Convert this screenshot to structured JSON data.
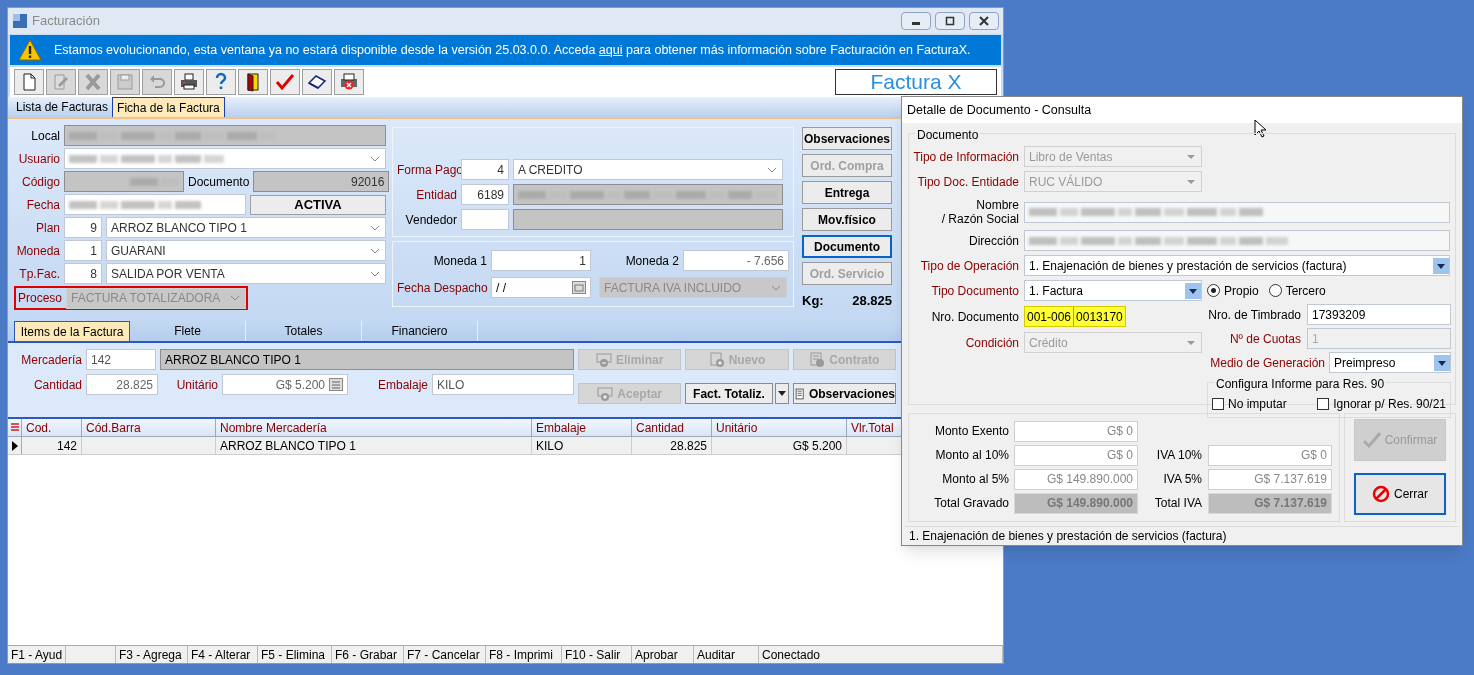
{
  "main": {
    "title": "Facturación",
    "notice": {
      "before": "Estamos evolucionando, esta ventana ya no estará disponible desde la versión 25.03.0.0. Acceda",
      "link": "aqui",
      "after": "para obtener más información sobre Facturación en FacturaX."
    },
    "toolbar": [
      {
        "kind": "new",
        "disabled": false
      },
      {
        "kind": "edit",
        "disabled": true
      },
      {
        "kind": "delete",
        "disabled": true
      },
      {
        "kind": "save",
        "disabled": true
      },
      {
        "kind": "undo",
        "disabled": true
      },
      {
        "kind": "print",
        "disabled": false
      },
      {
        "kind": "help",
        "disabled": false
      },
      {
        "kind": "exit",
        "disabled": false
      },
      {
        "kind": "check",
        "disabled": false
      },
      {
        "kind": "eraser",
        "disabled": false
      },
      {
        "kind": "print_cancel",
        "disabled": false
      }
    ],
    "logo": "Factura X",
    "tabs": [
      {
        "label": "Lista de Facturas",
        "selected": false
      },
      {
        "label": "Ficha de la Factura",
        "selected": true
      }
    ],
    "local": {
      "label": "Local",
      "required": false
    },
    "usuario": {
      "label": "Usuario",
      "required": true
    },
    "codigo": {
      "label": "Código",
      "required": true
    },
    "documento": {
      "label": "Documento",
      "value": "92016",
      "required": false
    },
    "fecha": {
      "label": "Fecha",
      "required": true
    },
    "status": "ACTIVA",
    "plan": {
      "label": "Plan",
      "code": "9",
      "value": "ARROZ BLANCO TIPO 1",
      "required": true
    },
    "moneda": {
      "label": "Moneda",
      "code": "1",
      "value": "GUARANI",
      "required": true
    },
    "tp_fac": {
      "label": "Tp.Fac.",
      "code": "8",
      "value": "SALIDA POR VENTA",
      "required": true
    },
    "proceso": {
      "label": "Proceso",
      "value": "FACTURA TOTALIZADORA",
      "required": true,
      "disabled": true,
      "highlighted": true
    },
    "forma_pago": {
      "label": "Forma Pago",
      "code": "4",
      "value": "A CREDITO",
      "required": true
    },
    "entidad": {
      "label": "Entidad",
      "code": "6189",
      "required": true
    },
    "vendedor": {
      "label": "Vendedor",
      "required": false
    },
    "moneda_1": {
      "label": "Moneda 1",
      "value": "1",
      "required": false
    },
    "moneda_2": {
      "label": "Moneda 2",
      "value": "- 7.656",
      "required": false
    },
    "fecha_despacho": {
      "label": "Fecha Despacho",
      "value": "/  /",
      "required": true
    },
    "tipo_factura": {
      "value": "FACTURA IVA INCLUIDO",
      "disabled": true
    },
    "side_buttons": [
      {
        "label": "Observaciones",
        "disabled": false,
        "focused": false
      },
      {
        "label": "Ord. Compra",
        "disabled": true,
        "focused": false
      },
      {
        "label": "Entrega",
        "disabled": false,
        "focused": false
      },
      {
        "label": "Mov.físico",
        "disabled": false,
        "focused": false
      },
      {
        "label": "Documento",
        "disabled": false,
        "focused": true
      },
      {
        "label": "Ord. Servicio",
        "disabled": true,
        "focused": false
      }
    ],
    "kg": {
      "label": "Kg:",
      "value": "28.825"
    },
    "item_tabs": [
      {
        "label": "Items de la Factura",
        "selected": true
      },
      {
        "label": "Flete",
        "selected": false
      },
      {
        "label": "Totales",
        "selected": false
      },
      {
        "label": "Financiero",
        "selected": false
      }
    ],
    "mercaderia": {
      "label": "Mercadería",
      "code": "142",
      "value": "ARROZ BLANCO TIPO 1",
      "required": true
    },
    "cantidad": {
      "label": "Cantidad",
      "value": "28.825",
      "required": true
    },
    "unitario": {
      "label": "Unitário",
      "value": "G$ 5.200",
      "required": true
    },
    "embalaje": {
      "label": "Embalaje",
      "value": "KILO",
      "required": true
    },
    "item_buttons": [
      {
        "label": "Eliminar",
        "kind": "remove",
        "disabled": true
      },
      {
        "label": "Nuevo",
        "kind": "add",
        "disabled": true
      },
      {
        "label": "Contrato",
        "kind": "contract",
        "disabled": true
      },
      {
        "label": "Aceptar",
        "kind": "accept",
        "disabled": true
      },
      {
        "label": "Fact. Totaliz.",
        "kind": "split",
        "disabled": false
      },
      {
        "label": "Observaciones",
        "kind": "notes",
        "disabled": false
      }
    ],
    "table": {
      "columns": [
        "Cod.",
        "Cód.Barra",
        "Nombre Mercadería",
        "Embalaje",
        "Cantidad",
        "Unitário",
        "Vlr.Total"
      ],
      "rows": [
        {
          "selected": true,
          "cod": "142",
          "nombre": "ARROZ BLANCO TIPO 1",
          "embalaje": "KILO",
          "cantidad": "28.825",
          "unitario": "G$ 5.200"
        }
      ]
    },
    "status_bar": [
      "F1 - Ayud",
      "F3 - Agrega",
      "F4 - Alterar",
      "F5 - Elimina",
      "F6 - Grabar",
      "F7 - Cancelar",
      "F8 - Imprimi",
      "F10 - Salir",
      "Aprobar",
      "Auditar",
      "Conectado"
    ]
  },
  "dialog": {
    "title": "Detalle de Documento - Consulta",
    "group": "Documento",
    "tipo_informacion": {
      "label": "Tipo de Información",
      "value": "Libro de Ventas",
      "required": true,
      "disabled": true
    },
    "tipo_doc_entidad": {
      "label": "Tipo Doc. Entidade",
      "value": "RUC VÁLIDO",
      "required": true,
      "disabled": true
    },
    "nombre": {
      "label_lines": [
        "Nombre",
        "/ Razón Social"
      ],
      "required": false
    },
    "direccion": {
      "label": "Dirección",
      "required": false
    },
    "tipo_operacion": {
      "label": "Tipo de Operación",
      "value": "1. Enajenación de bienes y prestación de servicios (factura)",
      "required": true,
      "disabled": false
    },
    "tipo_documento": {
      "label": "Tipo Documento",
      "value": "1. Factura",
      "required": true,
      "disabled": false
    },
    "radios": [
      {
        "label": "Propio",
        "selected": true
      },
      {
        "label": "Tercero",
        "selected": false
      }
    ],
    "nro_documento": {
      "label": "Nro. Documento",
      "parts": [
        "001-006",
        "0013170"
      ],
      "required": false,
      "highlighted": true
    },
    "nro_timbrado": {
      "label": "Nro. de Timbrado",
      "value": "17393209",
      "required": false
    },
    "condicion": {
      "label": "Condición",
      "value": "Crédito",
      "required": true,
      "disabled": true
    },
    "nro_cuotas": {
      "label": "Nº de Cuotas",
      "value": "1",
      "required": true,
      "disabled": true
    },
    "medio_generacion": {
      "label": "Medio de Generación",
      "value": "Preimpreso",
      "required": true,
      "disabled": false
    },
    "config": {
      "title": "Configura Informe para Res. 90",
      "checks": [
        {
          "label": "No imputar",
          "checked": false
        },
        {
          "label": "Ignorar p/ Res. 90/21",
          "checked": false
        }
      ]
    },
    "amounts": [
      {
        "label": "Monto Exento",
        "value": "G$ 0",
        "kind": "input"
      },
      {
        "label": "Monto al 10%",
        "value": "G$ 0",
        "kind": "input"
      },
      {
        "label": "IVA 10%",
        "value": "G$ 0",
        "kind": "input"
      },
      {
        "label": "Monto al 5%",
        "value": "G$ 149.890.000",
        "kind": "input"
      },
      {
        "label": "IVA 5%",
        "value": "G$ 7.137.619",
        "kind": "input"
      },
      {
        "label": "Total Gravado",
        "value": "G$ 149.890.000",
        "kind": "total"
      },
      {
        "label": "Total IVA",
        "value": "G$ 7.137.619",
        "kind": "total"
      }
    ],
    "buttons": [
      {
        "label": "Confirmar",
        "kind": "confirm",
        "disabled": true,
        "focused": false
      },
      {
        "label": "Cerrar",
        "kind": "close",
        "disabled": false,
        "focused": true
      }
    ],
    "status": "1. Enajenación de bienes y prestación de servicios (factura)"
  }
}
